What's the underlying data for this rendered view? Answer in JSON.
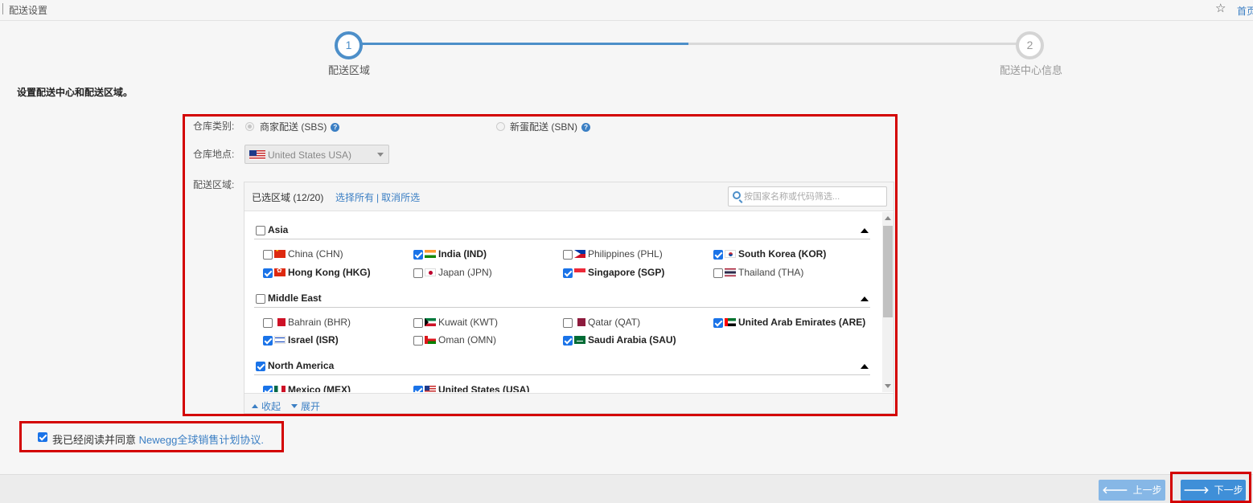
{
  "topbar": {
    "title": "配送设置",
    "home_link": "首页",
    "star_icon": "star-icon"
  },
  "stepper": {
    "steps": [
      {
        "number": "1",
        "label": "配送区域",
        "state": "active"
      },
      {
        "number": "2",
        "label": "配送中心信息",
        "state": "inactive"
      }
    ],
    "active_color": "#4d8fc9"
  },
  "intro": "设置配送中心和配送区域。",
  "form": {
    "warehouse_type_label": "仓库类别:",
    "warehouse_type_options": [
      {
        "label": "商家配送 (SBS)",
        "selected": true
      },
      {
        "label": "新蛋配送 (SBN)",
        "selected": false
      }
    ],
    "location_label": "仓库地点:",
    "location_value": "United States USA)",
    "zone_label": "配送区域:"
  },
  "zone": {
    "selected_count": "已选区域 (12/20)",
    "select_all": "选择所有",
    "separator": "|",
    "deselect_all": "取消所选",
    "search_placeholder": "按国家名称或代码筛选...",
    "collapse": "收起",
    "expand": "展开",
    "regions": [
      {
        "name": "Asia",
        "checked": false,
        "countries": [
          {
            "name": "China (CHN)",
            "checked": false,
            "flag": "chn"
          },
          {
            "name": "India (IND)",
            "checked": true,
            "flag": "ind"
          },
          {
            "name": "Philippines (PHL)",
            "checked": false,
            "flag": "phl"
          },
          {
            "name": "South Korea (KOR)",
            "checked": true,
            "flag": "kor"
          },
          {
            "name": "Hong Kong (HKG)",
            "checked": true,
            "flag": "hkg"
          },
          {
            "name": "Japan (JPN)",
            "checked": false,
            "flag": "jpn"
          },
          {
            "name": "Singapore (SGP)",
            "checked": true,
            "flag": "sgp"
          },
          {
            "name": "Thailand (THA)",
            "checked": false,
            "flag": "tha"
          }
        ]
      },
      {
        "name": "Middle East",
        "checked": false,
        "countries": [
          {
            "name": "Bahrain (BHR)",
            "checked": false,
            "flag": "bhr"
          },
          {
            "name": "Kuwait (KWT)",
            "checked": false,
            "flag": "kwt"
          },
          {
            "name": "Qatar (QAT)",
            "checked": false,
            "flag": "qat"
          },
          {
            "name": "United Arab Emirates (ARE)",
            "checked": true,
            "flag": "are"
          },
          {
            "name": "Israel (ISR)",
            "checked": true,
            "flag": "isr"
          },
          {
            "name": "Oman (OMN)",
            "checked": false,
            "flag": "omn"
          },
          {
            "name": "Saudi Arabia (SAU)",
            "checked": true,
            "flag": "sau"
          }
        ]
      },
      {
        "name": "North America",
        "checked": true,
        "countries": [
          {
            "name": "Mexico (MEX)",
            "checked": true,
            "flag": "mex"
          },
          {
            "name": "United States (USA)",
            "checked": true,
            "flag": "usa"
          }
        ]
      }
    ]
  },
  "agreement": {
    "checked": true,
    "text": "我已经阅读并同意 ",
    "link": "Newegg全球销售计划协议."
  },
  "buttons": {
    "prev": "上一步",
    "next": "下一步"
  },
  "colors": {
    "highlight_border": "#d30000",
    "link": "#3b7fc4",
    "checkbox": "#1a73e8"
  }
}
